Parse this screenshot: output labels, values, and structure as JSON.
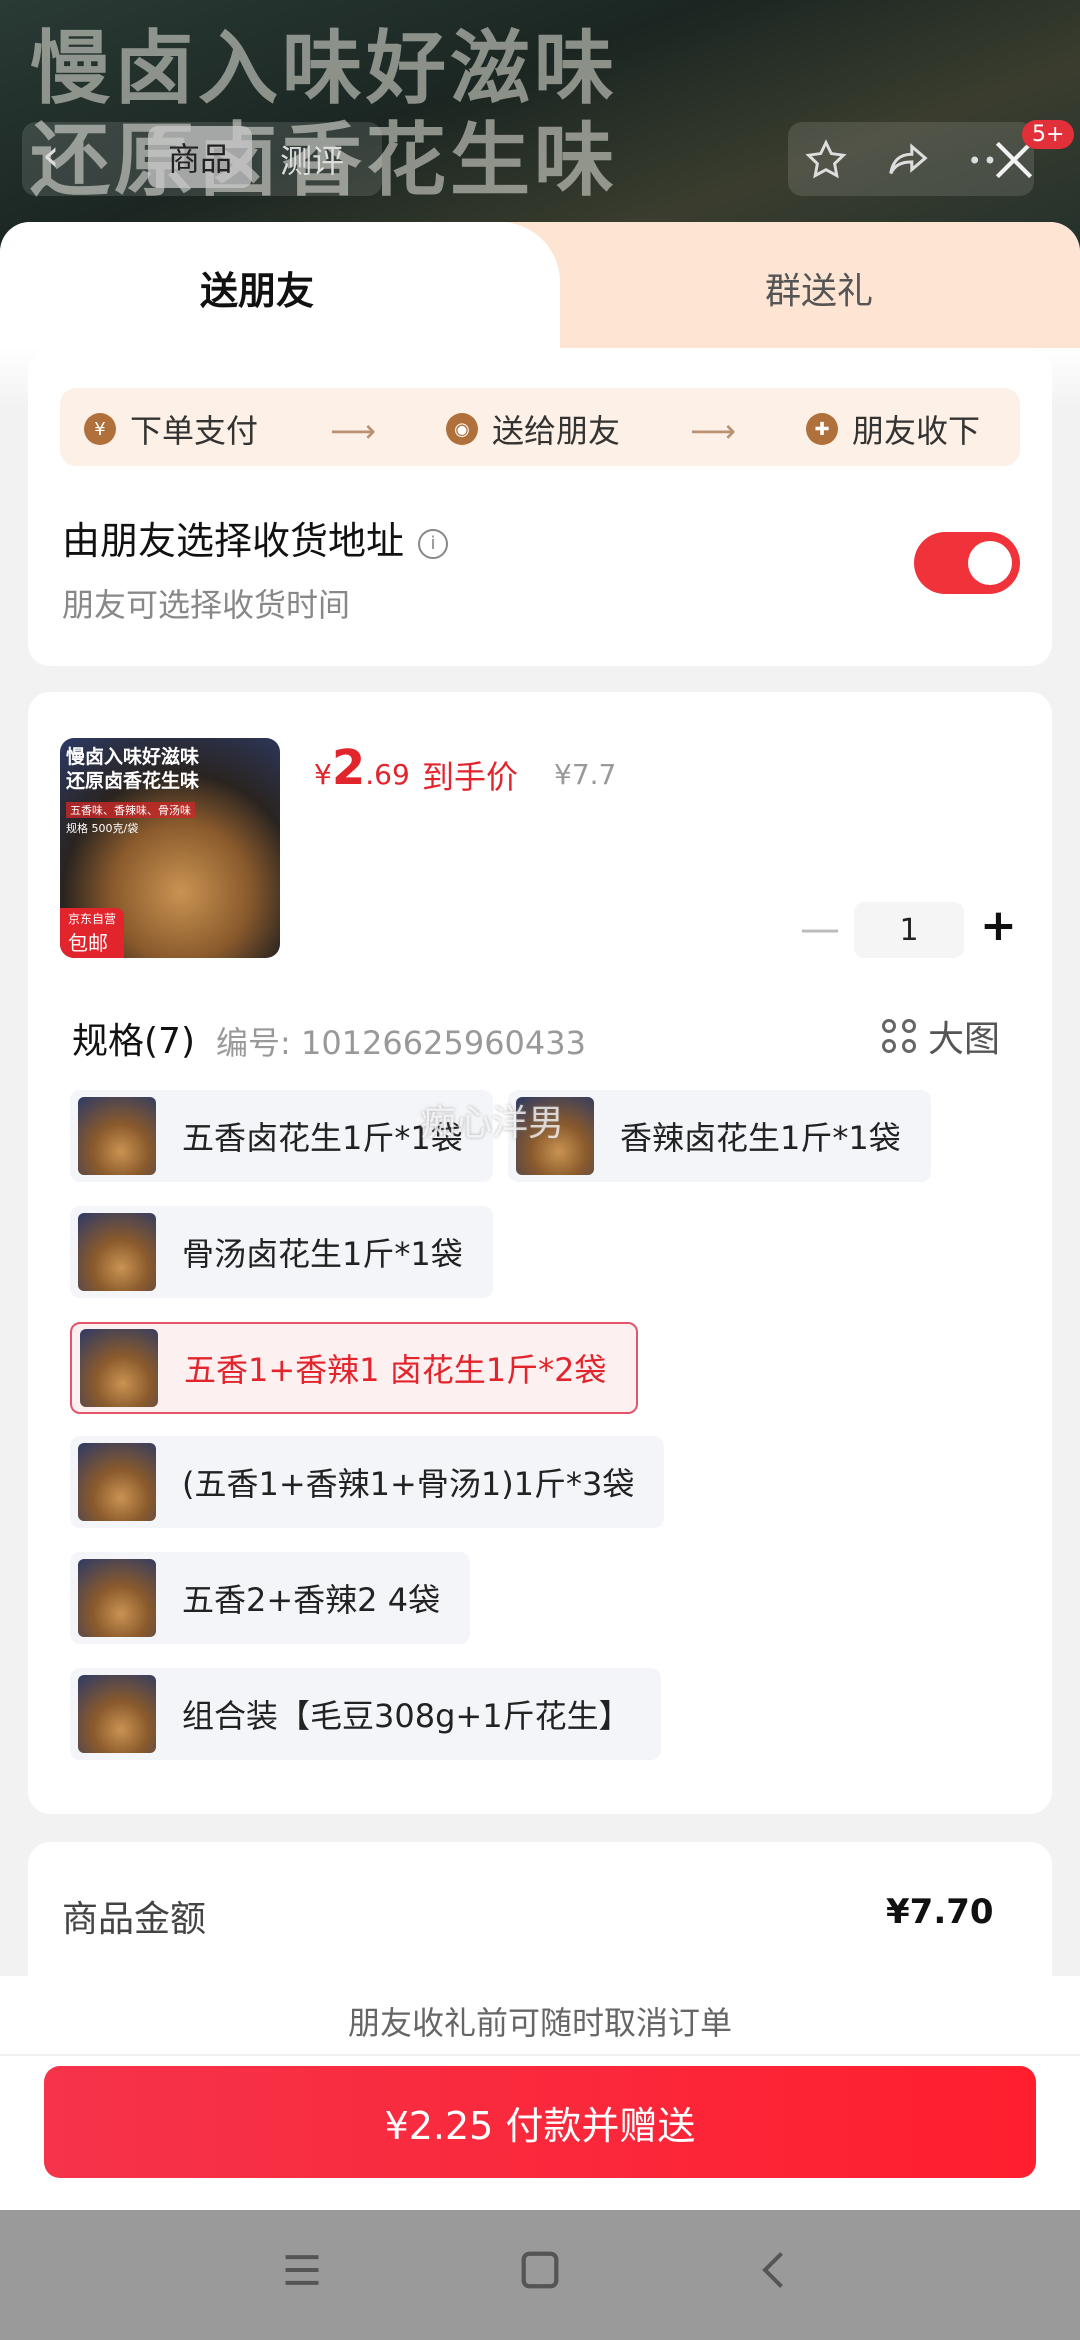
{
  "banner": {
    "line1": "慢卤入味好滋味",
    "line2": "还原卤香花生味",
    "tab_goods": "商品",
    "tab_review": "测评",
    "badge": "5+"
  },
  "sheet_tabs": {
    "send_friend": "送朋友",
    "group_gift": "群送礼"
  },
  "steps": [
    {
      "icon": "yen-icon",
      "label": "下单支付"
    },
    {
      "icon": "chat-icon",
      "label": "送给朋友"
    },
    {
      "icon": "gift-icon",
      "label": "朋友收下"
    }
  ],
  "address": {
    "title": "由朋友选择收货地址",
    "subtitle": "朋友可选择收货时间",
    "toggle_on": true
  },
  "product": {
    "image_line1": "慢卤入味好滋味",
    "image_line2": "还原卤香花生味",
    "image_line3": "五香味、香辣味、骨汤味",
    "image_line4": "规格 500克/袋",
    "image_tag": "包邮",
    "image_tag_top": "京东自营",
    "price_currency": "¥",
    "price_int": "2",
    "price_dec": ".69",
    "price_label": "到手价",
    "original_price": "¥7.7",
    "quantity": "1"
  },
  "spec": {
    "title": "规格(7)",
    "code": "编号: 10126625960433",
    "big_view": "大图",
    "options": [
      {
        "label": "五香卤花生1斤*1袋",
        "selected": false
      },
      {
        "label": "香辣卤花生1斤*1袋",
        "selected": false
      },
      {
        "label": "骨汤卤花生1斤*1袋",
        "selected": false
      },
      {
        "label": "五香1+香辣1 卤花生1斤*2袋",
        "selected": true
      },
      {
        "label": "(五香1+香辣1+骨汤1)1斤*3袋",
        "selected": false
      },
      {
        "label": "五香2+香辣2  4袋",
        "selected": false
      },
      {
        "label": "组合装【毛豆308g+1斤花生】",
        "selected": false
      }
    ]
  },
  "watermark": "痴心洋男",
  "summary": {
    "label": "商品金额",
    "value": "¥7.70"
  },
  "footer": {
    "notice": "朋友收礼前可随时取消订单",
    "pay_button": "¥2.25 付款并赠送"
  },
  "colors": {
    "accent": "#e2242c",
    "tab_bg": "#fde4d3",
    "steps_bg": "#fdf0e6"
  }
}
